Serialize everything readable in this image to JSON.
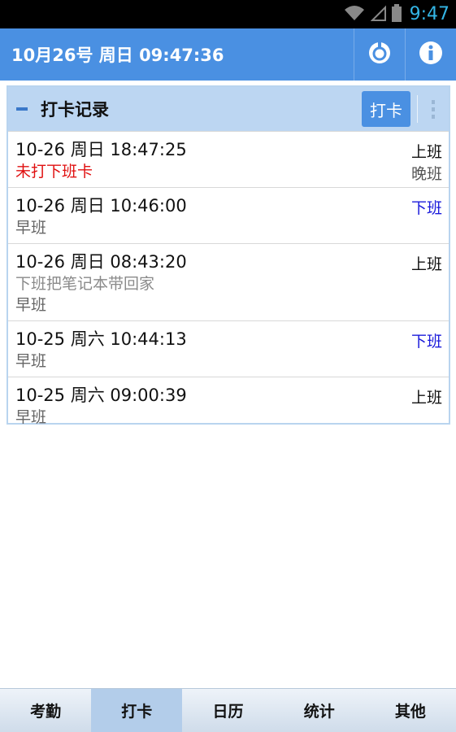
{
  "statusbar": {
    "time": "9:47",
    "wifi_icon": "wifi-icon",
    "signal_icon": "signal-icon",
    "battery_icon": "battery-icon"
  },
  "appbar": {
    "title": "10月26号 周日 09:47:36",
    "settings_icon": "sync-icon",
    "info_icon": "info-icon"
  },
  "panel": {
    "title": "打卡记录",
    "punch_label": "打卡",
    "records": [
      {
        "datetime": "10-26 周日 18:47:25",
        "type": "上班",
        "type_kind": "on",
        "line2": "未打下班卡",
        "line2_kind": "red",
        "right_shift": "晚班",
        "line3": ""
      },
      {
        "datetime": "10-26 周日 10:46:00",
        "type": "下班",
        "type_kind": "off",
        "line2": "早班",
        "line2_kind": "gray",
        "right_shift": "",
        "line3": ""
      },
      {
        "datetime": "10-26 周日 08:43:20",
        "type": "上班",
        "type_kind": "on",
        "line2": "下班把笔记本带回家",
        "line2_kind": "note",
        "right_shift": "",
        "line3": "早班"
      },
      {
        "datetime": "10-25 周六 10:44:13",
        "type": "下班",
        "type_kind": "off",
        "line2": "早班",
        "line2_kind": "gray",
        "right_shift": "",
        "line3": ""
      },
      {
        "datetime": "10-25 周六 09:00:39",
        "type": "上班",
        "type_kind": "on",
        "line2": "早班",
        "line2_kind": "gray",
        "right_shift": "",
        "line3": ""
      }
    ]
  },
  "tabs": [
    {
      "label": "考勤",
      "active": false
    },
    {
      "label": "打卡",
      "active": true
    },
    {
      "label": "日历",
      "active": false
    },
    {
      "label": "统计",
      "active": false
    },
    {
      "label": "其他",
      "active": false
    }
  ],
  "colors": {
    "accent": "#4a90e2",
    "panel_header": "#bcd6f2",
    "off_duty": "#1a1adb",
    "missing": "#e01010"
  }
}
